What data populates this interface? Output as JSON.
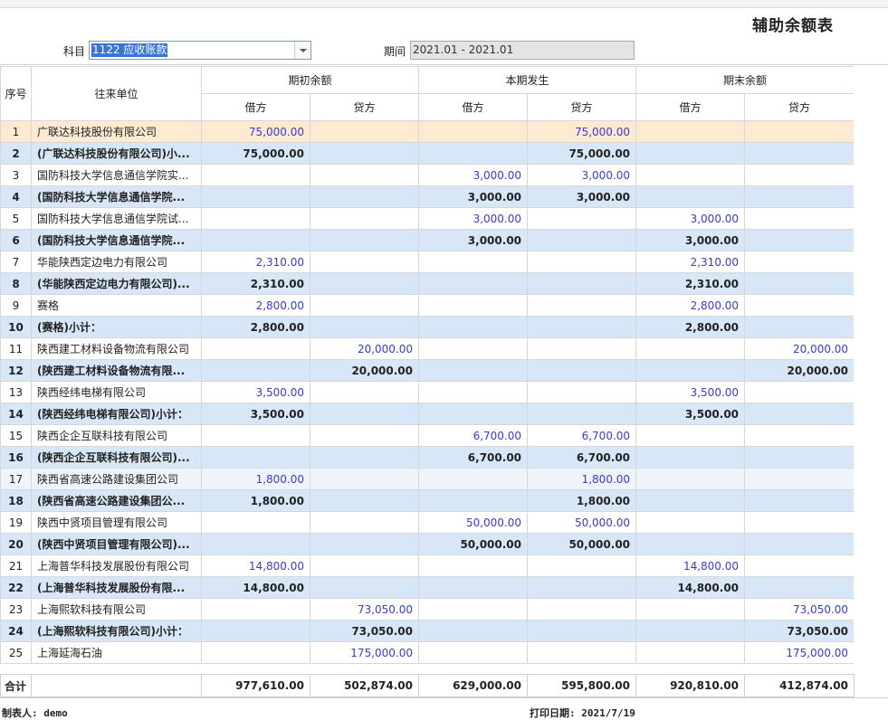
{
  "title": "辅助余额表",
  "filters": {
    "subject_label": "科目",
    "subject_value": "1122 应收账款",
    "period_label": "期间",
    "period_value": "2021.01 - 2021.01"
  },
  "columns": {
    "index": "序号",
    "unit": "往来单位",
    "groups": [
      "期初余额",
      "本期发生",
      "期末余额"
    ],
    "debit": "借方",
    "credit": "贷方"
  },
  "rows": [
    {
      "i": "1",
      "name": "广联达科技股份有限公司",
      "v": [
        "75,000.00",
        "",
        "",
        "75,000.00",
        "",
        ""
      ],
      "kind": "hl"
    },
    {
      "i": "2",
      "name": "(广联达科技股份有限公司)小...",
      "v": [
        "75,000.00",
        "",
        "",
        "75,000.00",
        "",
        ""
      ],
      "kind": "sub"
    },
    {
      "i": "3",
      "name": "国防科技大学信息通信学院实...",
      "v": [
        "",
        "",
        "3,000.00",
        "3,000.00",
        "",
        ""
      ],
      "kind": "row"
    },
    {
      "i": "4",
      "name": "(国防科技大学信息通信学院...",
      "v": [
        "",
        "",
        "3,000.00",
        "3,000.00",
        "",
        ""
      ],
      "kind": "sub"
    },
    {
      "i": "5",
      "name": "国防科技大学信息通信学院试...",
      "v": [
        "",
        "",
        "3,000.00",
        "",
        "3,000.00",
        ""
      ],
      "kind": "row"
    },
    {
      "i": "6",
      "name": "(国防科技大学信息通信学院...",
      "v": [
        "",
        "",
        "3,000.00",
        "",
        "3,000.00",
        ""
      ],
      "kind": "sub"
    },
    {
      "i": "7",
      "name": "华能陕西定边电力有限公司",
      "v": [
        "2,310.00",
        "",
        "",
        "",
        "2,310.00",
        ""
      ],
      "kind": "row"
    },
    {
      "i": "8",
      "name": "(华能陕西定边电力有限公司)...",
      "v": [
        "2,310.00",
        "",
        "",
        "",
        "2,310.00",
        ""
      ],
      "kind": "sub"
    },
    {
      "i": "9",
      "name": "赛格",
      "v": [
        "2,800.00",
        "",
        "",
        "",
        "2,800.00",
        ""
      ],
      "kind": "row"
    },
    {
      "i": "10",
      "name": "(赛格)小计：",
      "v": [
        "2,800.00",
        "",
        "",
        "",
        "2,800.00",
        ""
      ],
      "kind": "sub"
    },
    {
      "i": "11",
      "name": "陕西建工材料设备物流有限公司",
      "v": [
        "",
        "20,000.00",
        "",
        "",
        "",
        "20,000.00"
      ],
      "kind": "row"
    },
    {
      "i": "12",
      "name": "(陕西建工材料设备物流有限...",
      "v": [
        "",
        "20,000.00",
        "",
        "",
        "",
        "20,000.00"
      ],
      "kind": "sub"
    },
    {
      "i": "13",
      "name": "陕西经纬电梯有限公司",
      "v": [
        "3,500.00",
        "",
        "",
        "",
        "3,500.00",
        ""
      ],
      "kind": "row"
    },
    {
      "i": "14",
      "name": "(陕西经纬电梯有限公司)小计：",
      "v": [
        "3,500.00",
        "",
        "",
        "",
        "3,500.00",
        ""
      ],
      "kind": "sub"
    },
    {
      "i": "15",
      "name": "陕西企企互联科技有限公司",
      "v": [
        "",
        "",
        "6,700.00",
        "6,700.00",
        "",
        ""
      ],
      "kind": "row"
    },
    {
      "i": "16",
      "name": "(陕西企企互联科技有限公司)...",
      "v": [
        "",
        "",
        "6,700.00",
        "6,700.00",
        "",
        ""
      ],
      "kind": "sub"
    },
    {
      "i": "17",
      "name": "陕西省高速公路建设集团公司",
      "v": [
        "1,800.00",
        "",
        "",
        "1,800.00",
        "",
        ""
      ],
      "kind": "alt"
    },
    {
      "i": "18",
      "name": "(陕西省高速公路建设集团公...",
      "v": [
        "1,800.00",
        "",
        "",
        "1,800.00",
        "",
        ""
      ],
      "kind": "sub"
    },
    {
      "i": "19",
      "name": "陕西中贤项目管理有限公司",
      "v": [
        "",
        "",
        "50,000.00",
        "50,000.00",
        "",
        ""
      ],
      "kind": "row"
    },
    {
      "i": "20",
      "name": "(陕西中贤项目管理有限公司)...",
      "v": [
        "",
        "",
        "50,000.00",
        "50,000.00",
        "",
        ""
      ],
      "kind": "sub"
    },
    {
      "i": "21",
      "name": "上海普华科技发展股份有限公司",
      "v": [
        "14,800.00",
        "",
        "",
        "",
        "14,800.00",
        ""
      ],
      "kind": "row"
    },
    {
      "i": "22",
      "name": "(上海普华科技发展股份有限...",
      "v": [
        "14,800.00",
        "",
        "",
        "",
        "14,800.00",
        ""
      ],
      "kind": "sub"
    },
    {
      "i": "23",
      "name": "上海熙软科技有限公司",
      "v": [
        "",
        "73,050.00",
        "",
        "",
        "",
        "73,050.00"
      ],
      "kind": "row"
    },
    {
      "i": "24",
      "name": "(上海熙软科技有限公司)小计：",
      "v": [
        "",
        "73,050.00",
        "",
        "",
        "",
        "73,050.00"
      ],
      "kind": "sub"
    },
    {
      "i": "25",
      "name": "上海延海石油",
      "v": [
        "",
        "175,000.00",
        "",
        "",
        "",
        "175,000.00"
      ],
      "kind": "row"
    }
  ],
  "total": {
    "label": "合计",
    "v": [
      "977,610.00",
      "502,874.00",
      "629,000.00",
      "595,800.00",
      "920,810.00",
      "412,874.00"
    ]
  },
  "footer": {
    "preparer": "制表人: demo",
    "print_date": "打印日期: 2021/7/19"
  }
}
